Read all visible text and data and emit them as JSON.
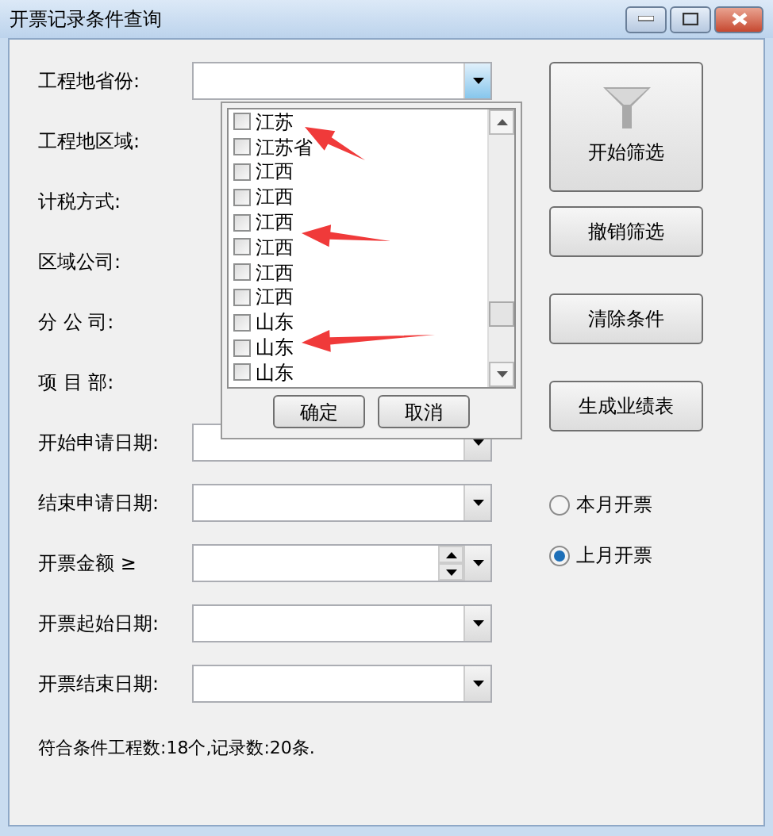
{
  "window": {
    "title": "开票记录条件查询",
    "controls": [
      {
        "kind": "minimize"
      },
      {
        "kind": "maximize"
      },
      {
        "kind": "close"
      }
    ]
  },
  "rows": [
    {
      "label": "工程地省份:",
      "kind": "combo"
    },
    {
      "label": "工程地区域:"
    },
    {
      "label": "计税方式:"
    },
    {
      "label": "区域公司:"
    },
    {
      "label": "分 公 司:"
    },
    {
      "label": "项 目 部:"
    },
    {
      "label": "开始申请日期:",
      "kind": "combo"
    },
    {
      "label": "结束申请日期:",
      "kind": "combo"
    },
    {
      "label": "开票金额 ≥",
      "kind": "spin"
    },
    {
      "label": "开票起始日期:",
      "kind": "combo"
    },
    {
      "label": "开票结束日期:",
      "kind": "combo"
    }
  ],
  "dropdown": {
    "items": [
      {
        "label": "江苏",
        "checked": false
      },
      {
        "label": "江苏省",
        "checked": false
      },
      {
        "label": "江西",
        "checked": false
      },
      {
        "label": "江西",
        "checked": false
      },
      {
        "label": "江西",
        "checked": false
      },
      {
        "label": "江西",
        "checked": false
      },
      {
        "label": "江西",
        "checked": false
      },
      {
        "label": "江西",
        "checked": false
      },
      {
        "label": "山东",
        "checked": false
      },
      {
        "label": "山东",
        "checked": false
      },
      {
        "label": "山东",
        "checked": false
      }
    ],
    "buttons": [
      "确定",
      "取消"
    ]
  },
  "buttons": [
    {
      "label": "开始筛选",
      "kind": "filter"
    },
    {
      "label": "撤销筛选"
    },
    {
      "label": "清除条件"
    },
    {
      "label": "生成业绩表"
    }
  ],
  "radios": [
    {
      "label": "本月开票",
      "selected": false
    },
    {
      "label": "上月开票",
      "selected": true
    }
  ],
  "status": "符合条件工程数:18个,记录数:20条."
}
